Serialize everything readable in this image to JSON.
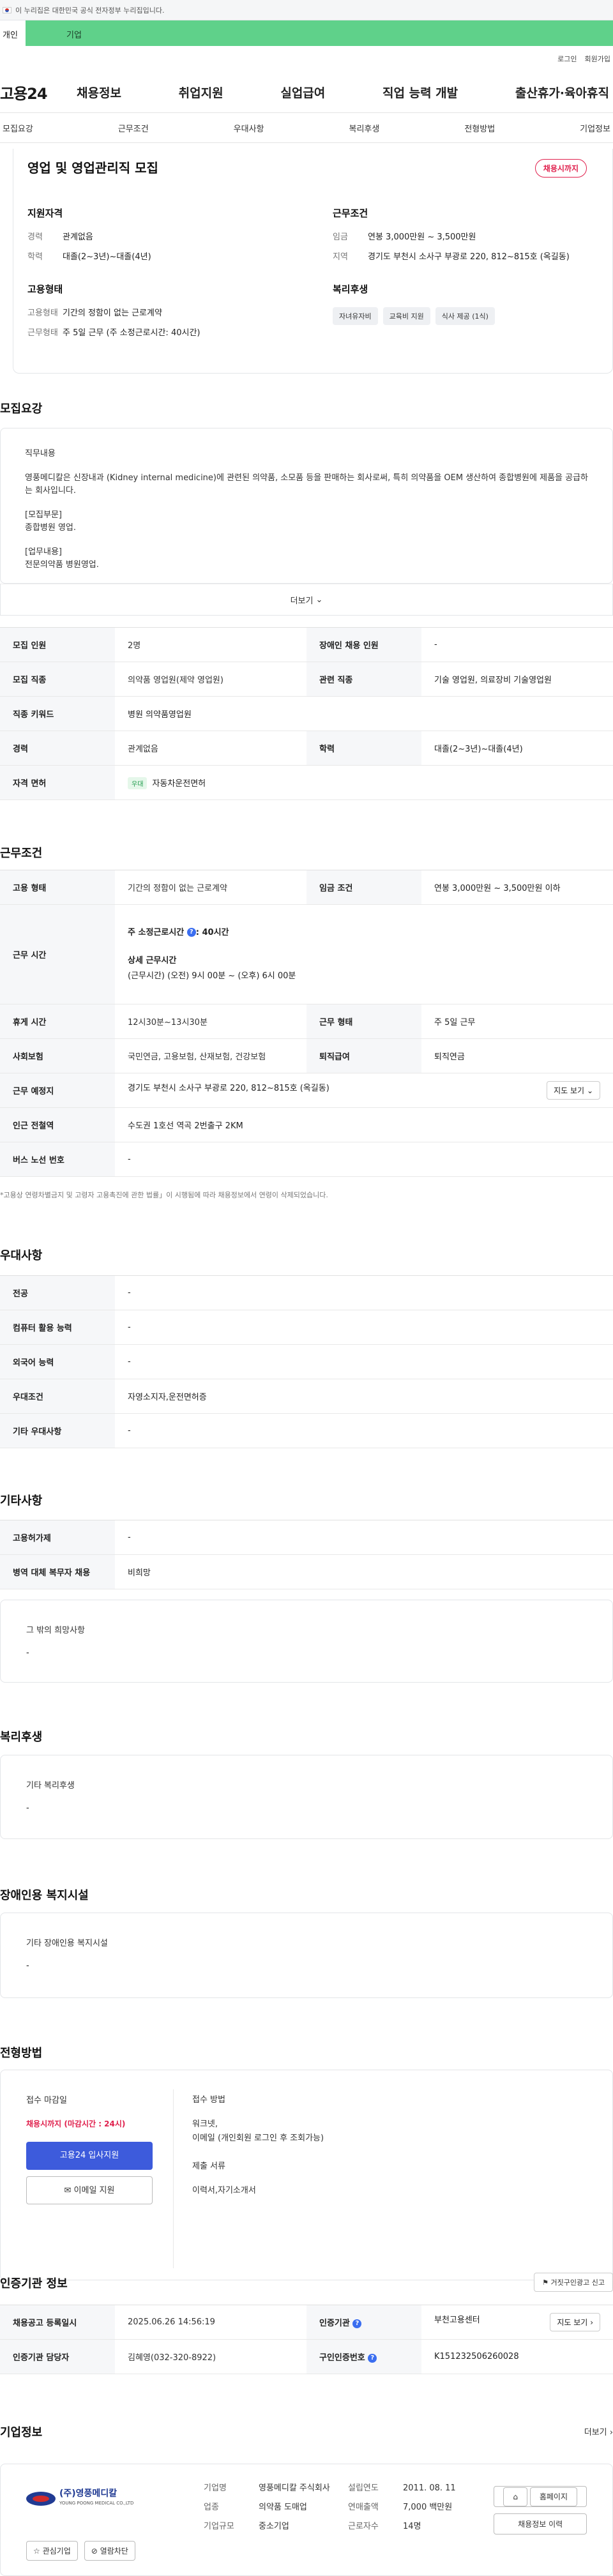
{
  "gov_banner": "이 누리집은 대한민국 공식 전자정부 누리집입니다.",
  "top_tabs": {
    "individual": "개인",
    "corporate": "기업"
  },
  "util": {
    "login": "로그인",
    "join": "회원가입"
  },
  "logo": "고용24",
  "gnb": [
    "채용정보",
    "취업지원",
    "실업급여",
    "직업 능력 개발",
    "출산휴가·육아휴직"
  ],
  "sub_tabs": [
    "모집요강",
    "근무조건",
    "우대사항",
    "복리후생",
    "전형방법",
    "기업정보"
  ],
  "summary": {
    "title": "영업 및 영업관리직 모집",
    "badge": "채용시까지",
    "qual_title": "지원자격",
    "qual": [
      {
        "k": "경력",
        "v": "관계없음"
      },
      {
        "k": "학력",
        "v": "대졸(2~3년)~대졸(4년)"
      }
    ],
    "cond_title": "근무조건",
    "cond": [
      {
        "k": "임금",
        "v": "연봉 3,000만원 ~ 3,500만원"
      },
      {
        "k": "지역",
        "v": "경기도 부천시 소사구 부광로 220, 812~815호 (옥길동)"
      }
    ],
    "emp_title": "고용형태",
    "emp": [
      {
        "k": "고용형태",
        "v": "기간의 정함이 없는 근로계약"
      },
      {
        "k": "근무형태",
        "v": "주 5일 근무 (주 소정근로시간: 40시간)"
      }
    ],
    "welfare_title": "복리후생",
    "welfare_chips": [
      "자녀유자비",
      "교육비 지원",
      "식사 제공 (1식)"
    ]
  },
  "recruit": {
    "title": "모집요강",
    "duty_label": "직무내용",
    "duty_text": "영풍메디칼은 신장내과 (Kidney internal medicine)에 관련된 의약품, 소모품 등을 판매하는 회사로써, 특히 의약품을 OEM 생산하여 종합병원에 제품을 공급하는 회사입니다.",
    "dept_label": "[모집부문]",
    "dept_text": "종합병원 영업.",
    "work_label": "[업무내용]",
    "work_text": "전문의약품 병원영업.",
    "more": "더보기",
    "rows": [
      [
        "모집 인원",
        "2명",
        "장애인 채용 인원",
        "-"
      ],
      [
        "모집 직종",
        "의약품 영업원(제약 영업원)",
        "관련 직종",
        "기술 영업원, 의료장비 기술영업원"
      ],
      [
        "직종 키워드",
        "병원 의약품영업원",
        "",
        ""
      ],
      [
        "경력",
        "관계없음",
        "학력",
        "대졸(2~3년)~대졸(4년)"
      ],
      [
        "자격 면허",
        "자동차운전면허",
        "",
        ""
      ]
    ],
    "license_tag": "우대"
  },
  "work_cond": {
    "title": "근무조건",
    "emp_type_k": "고용 형태",
    "emp_type_v": "기간의 정함이 없는 근로계약",
    "pay_k": "임금 조건",
    "pay_v": "연봉 3,000만원 ~ 3,500만원 이하",
    "hours_k": "근무 시간",
    "hours_weekly_label": "주 소정근로시간",
    "hours_weekly_value": ": 40시간",
    "hours_detail_label": "상세 근무시간",
    "hours_detail_value": "(근무시간) (오전) 9시 00분 ~ (오후) 6시 00분",
    "rest_k": "휴게 시간",
    "rest_v": "12시30분~13시30분",
    "shift_k": "근무 형태",
    "shift_v": "주 5일 근무",
    "ins_k": "사회보험",
    "ins_v": "국민연금, 고용보험, 산재보험, 건강보험",
    "ret_k": "퇴직급여",
    "ret_v": "퇴직연금",
    "loc_k": "근무 예정지",
    "loc_v": "경기도 부천시 소사구 부광로 220, 812~815호 (옥길동)",
    "map_btn": "지도 보기",
    "sub_k": "인근 전철역",
    "sub_v": "수도권 1호선 역곡 2번출구 2KM",
    "bus_k": "버스 노선 번호",
    "bus_v": "-",
    "note": "*고용상 연령차별금지 및 고령자 고용촉진에 관한 법률」이 시행됨에 따라 채용정보에서 연령이 삭제되었습니다."
  },
  "pref": {
    "title": "우대사항",
    "rows": [
      [
        "전공",
        "-"
      ],
      [
        "컴퓨터 활용 능력",
        "-"
      ],
      [
        "외국어 능력",
        "-"
      ],
      [
        "우대조건",
        "자영소지자,운전면허증"
      ],
      [
        "기타 우대사항",
        "-"
      ]
    ]
  },
  "etc": {
    "title": "기타사항",
    "rows": [
      [
        "고용허가제",
        "-"
      ],
      [
        "병역 대체 복무자 채용",
        "비희망"
      ]
    ],
    "other_label": "그 밖의 희망사항",
    "other_value": "-"
  },
  "welfare": {
    "title": "복리후생",
    "label": "기타 복리후생",
    "value": "-"
  },
  "disabled": {
    "title": "장애인용 복지시설",
    "label": "기타 장애인용 복지시설",
    "value": "-"
  },
  "apply": {
    "title": "전형방법",
    "deadline_label": "접수 마감일",
    "deadline_value": "채용시까지 (마감시간 : 24시)",
    "apply_btn": "고용24 입사지원",
    "email_btn": "이메일 지원",
    "method_label": "접수 방법",
    "method_value_1": "워크넷,",
    "method_value_2": "이메일 (개인회원 로그인 후 조회가능)",
    "docs_label": "제출 서류",
    "docs_value": "이력서,자기소개서"
  },
  "cert": {
    "title": "인증기관 정보",
    "report_btn": "거짓구인광고 신고",
    "reg_k": "채용공고 등록일시",
    "reg_v": "2025.06.26 14:56:19",
    "org_k": "인증기관",
    "org_v": "부천고용센터",
    "map_btn": "지도 보기",
    "mgr_k": "인증기관 담당자",
    "mgr_v": "김혜영(032-320-8922)",
    "no_k": "구인인증번호",
    "no_v": "K151232506260028"
  },
  "company": {
    "title": "기업정보",
    "more": "더보기",
    "logo_name": "(주)영풍메디칼",
    "logo_sub": "YOUNG POONG MEDICAL CO.,LTD",
    "fav_btn": "관심기업",
    "block_btn": "열람차단",
    "name_k": "기업명",
    "name_v": "영풍메디칼 주식회사",
    "date_k": "설립연도",
    "date_v": "2011. 08. 11",
    "biz_k": "업종",
    "biz_v": "의약품 도매업",
    "sales_k": "연매출액",
    "sales_v": "7,000 백만원",
    "size_k": "기업규모",
    "size_v": "중소기업",
    "emp_k": "근로자수",
    "emp_v": "14명",
    "home_btn": "홈페이지",
    "recruit_btn": "채용정보 이력"
  }
}
